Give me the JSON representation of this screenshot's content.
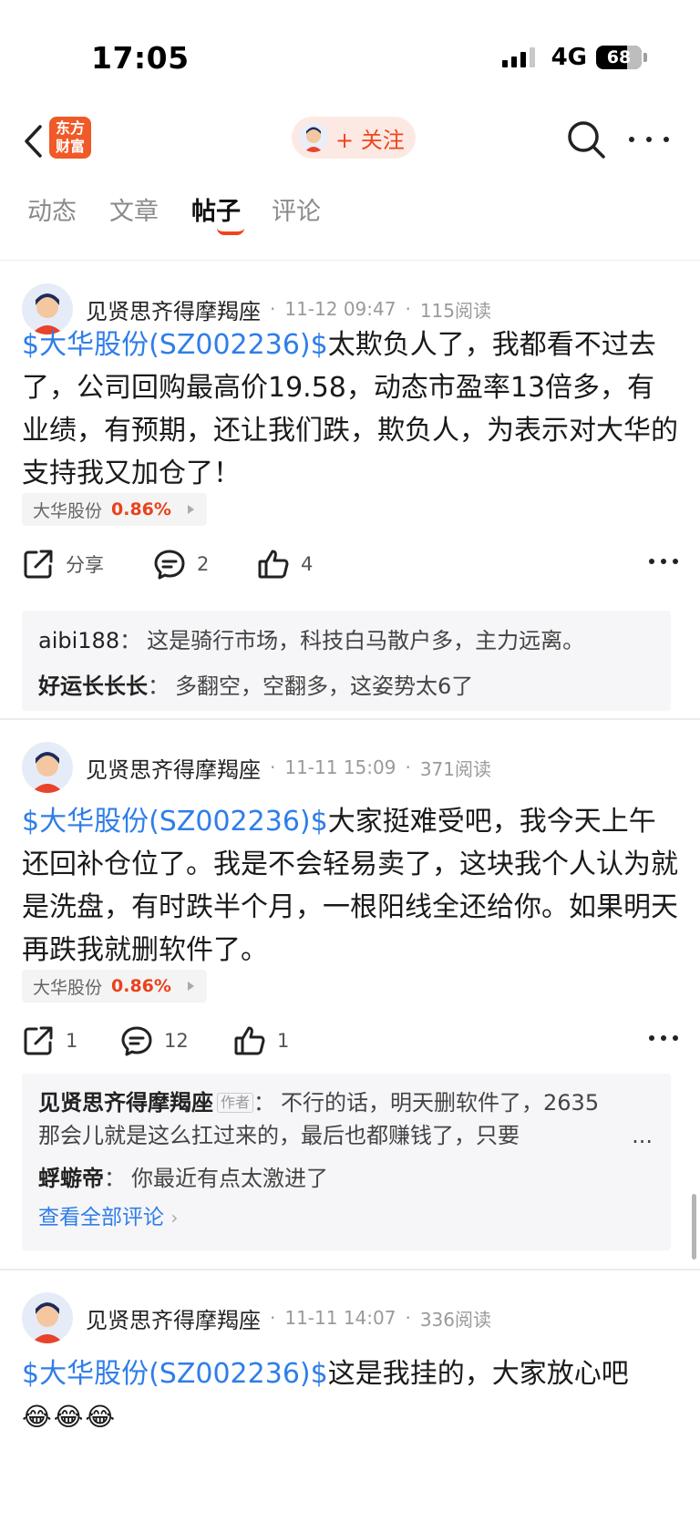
{
  "status_bar": {
    "time": "17:05",
    "network": "4G",
    "battery": "68",
    "battery_level_percent": 68
  },
  "header": {
    "logo_text": "东方财富",
    "follow_label": "+ 关注"
  },
  "tabs": [
    {
      "label": "动态"
    },
    {
      "label": "文章"
    },
    {
      "label": "帖子",
      "active": true
    },
    {
      "label": "评论"
    }
  ],
  "posts": [
    {
      "author": "见贤思齐得摩羯座",
      "date": "11-12 09:47",
      "reads": "115阅读",
      "stock_tag": "$大华股份(SZ002236)$",
      "text": "太欺负人了，我都看不过去了，公司回购最高价19.58，动态市盈率13倍多，有业绩，有预期，还让我们跌，欺负人，为表示对大华的支持我又加仓了！",
      "chip_name": "大华股份",
      "chip_pct": "0.86%",
      "share": "分享",
      "comment_count": "2",
      "like_count": "4",
      "comments": [
        {
          "user": "aibi188",
          "text": "这是骑行市场，科技白马散户多，主力远离。"
        },
        {
          "user": "好运长长长",
          "text": "多翻空，空翻多，这姿势太6了"
        }
      ]
    },
    {
      "author": "见贤思齐得摩羯座",
      "date": "11-11 15:09",
      "reads": "371阅读",
      "stock_tag": "$大华股份(SZ002236)$",
      "text": "大家挺难受吧，我今天上午还回补仓位了。我是不会轻易卖了，这块我个人认为就是洗盘，有时跌半个月，一根阳线全还给你。如果明天再跌我就删软件了。",
      "chip_name": "大华股份",
      "chip_pct": "0.86%",
      "share": "1",
      "comment_count": "12",
      "like_count": "1",
      "comments": [
        {
          "user": "见贤思齐得摩羯座",
          "tag": "作者",
          "text": "不行的话，明天删软件了，2635那会儿就是这么扛过来的，最后也都赚钱了，只要",
          "ellipsis": "..."
        },
        {
          "user": "蜉蝣帝",
          "text": "你最近有点太激进了"
        }
      ],
      "view_all": "查看全部评论"
    },
    {
      "author": "见贤思齐得摩羯座",
      "date": "11-11 14:07",
      "reads": "336阅读",
      "stock_tag": "$大华股份(SZ002236)$",
      "text": "这是我挂的，大家放心吧",
      "emojis": "😂😂😂"
    }
  ]
}
